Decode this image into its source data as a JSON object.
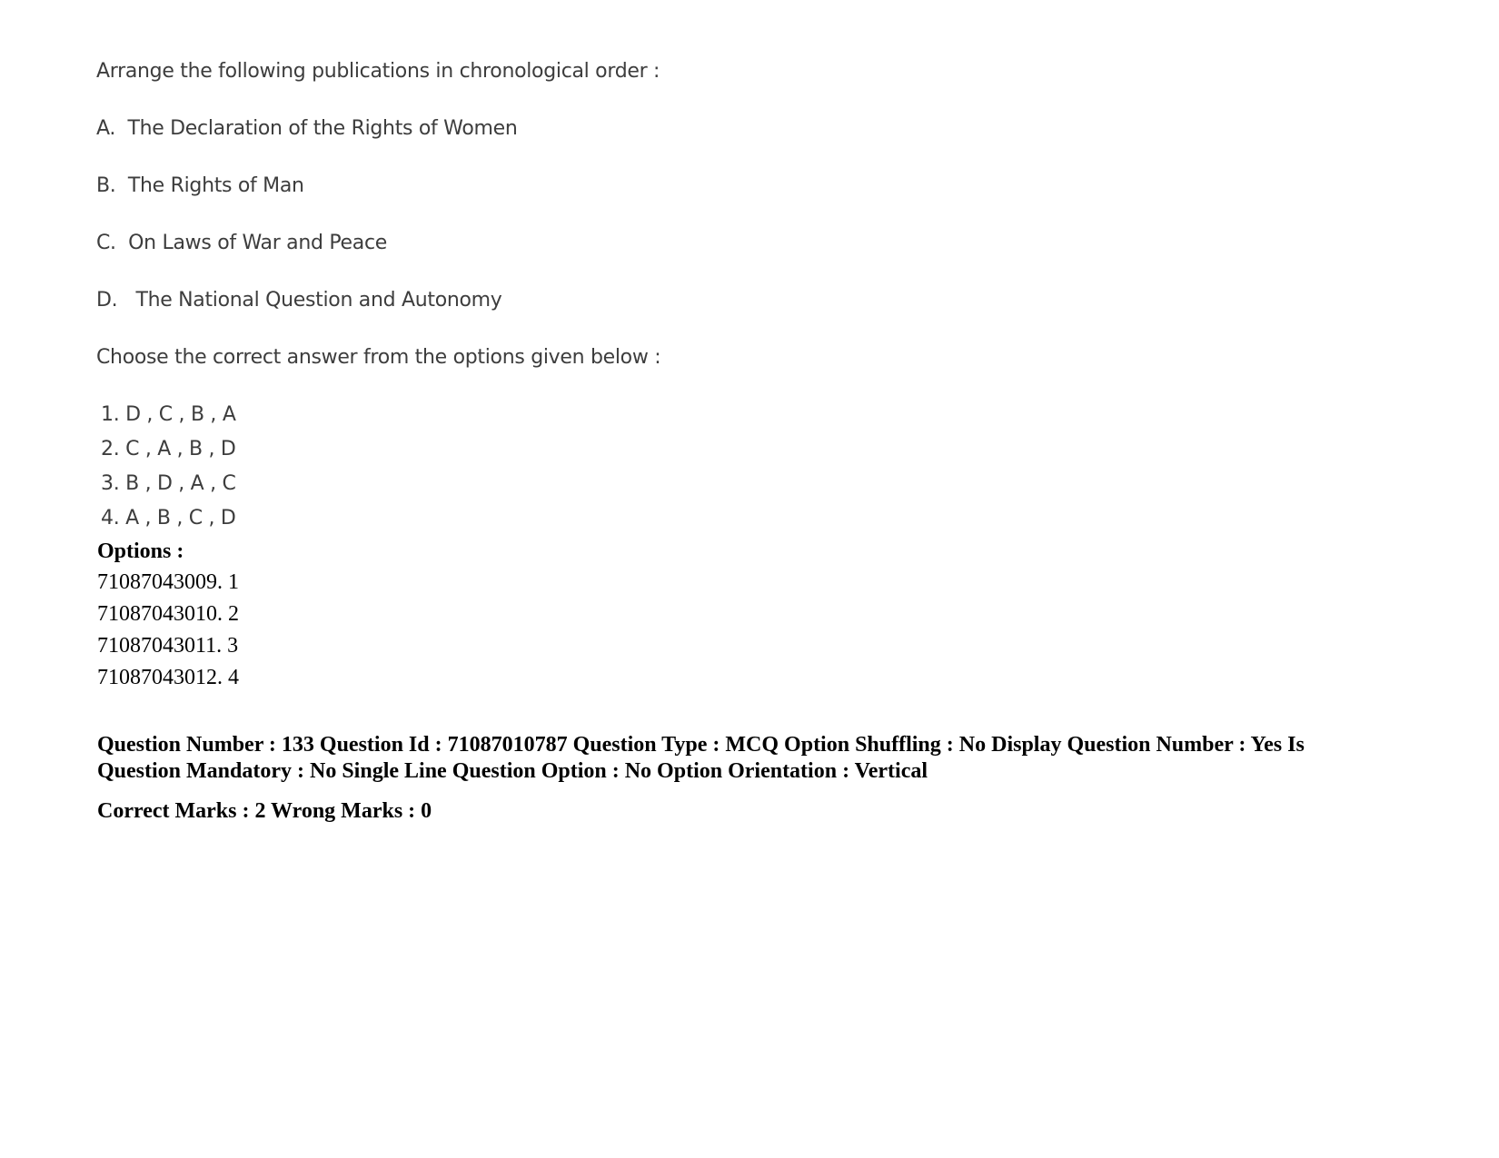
{
  "question": {
    "prompt": "Arrange the following publications in chronological order :",
    "items": [
      {
        "label": "A.",
        "text": "The Declaration of the Rights of Women"
      },
      {
        "label": "B.",
        "text": "The Rights of Man"
      },
      {
        "label": "C.",
        "text": "On Laws of War and Peace"
      },
      {
        "label": "D.",
        "text": "The National Question and Autonomy"
      }
    ],
    "instruction": "Choose the correct answer from the options given below :",
    "answers": [
      "1. D , C , B , A",
      "2. C , A , B , D",
      "3. B , D , A , C",
      "4. A , B , C , D"
    ]
  },
  "options": {
    "heading": "Options :",
    "list": [
      "71087043009. 1",
      "71087043010. 2",
      "71087043011. 3",
      "71087043012. 4"
    ]
  },
  "next_question_meta": {
    "details": "Question Number : 133 Question Id : 71087010787 Question Type : MCQ Option Shuffling : No Display Question Number : Yes Is Question Mandatory : No Single Line Question Option : No Option Orientation : Vertical",
    "marks": "Correct Marks : 2 Wrong Marks : 0"
  }
}
